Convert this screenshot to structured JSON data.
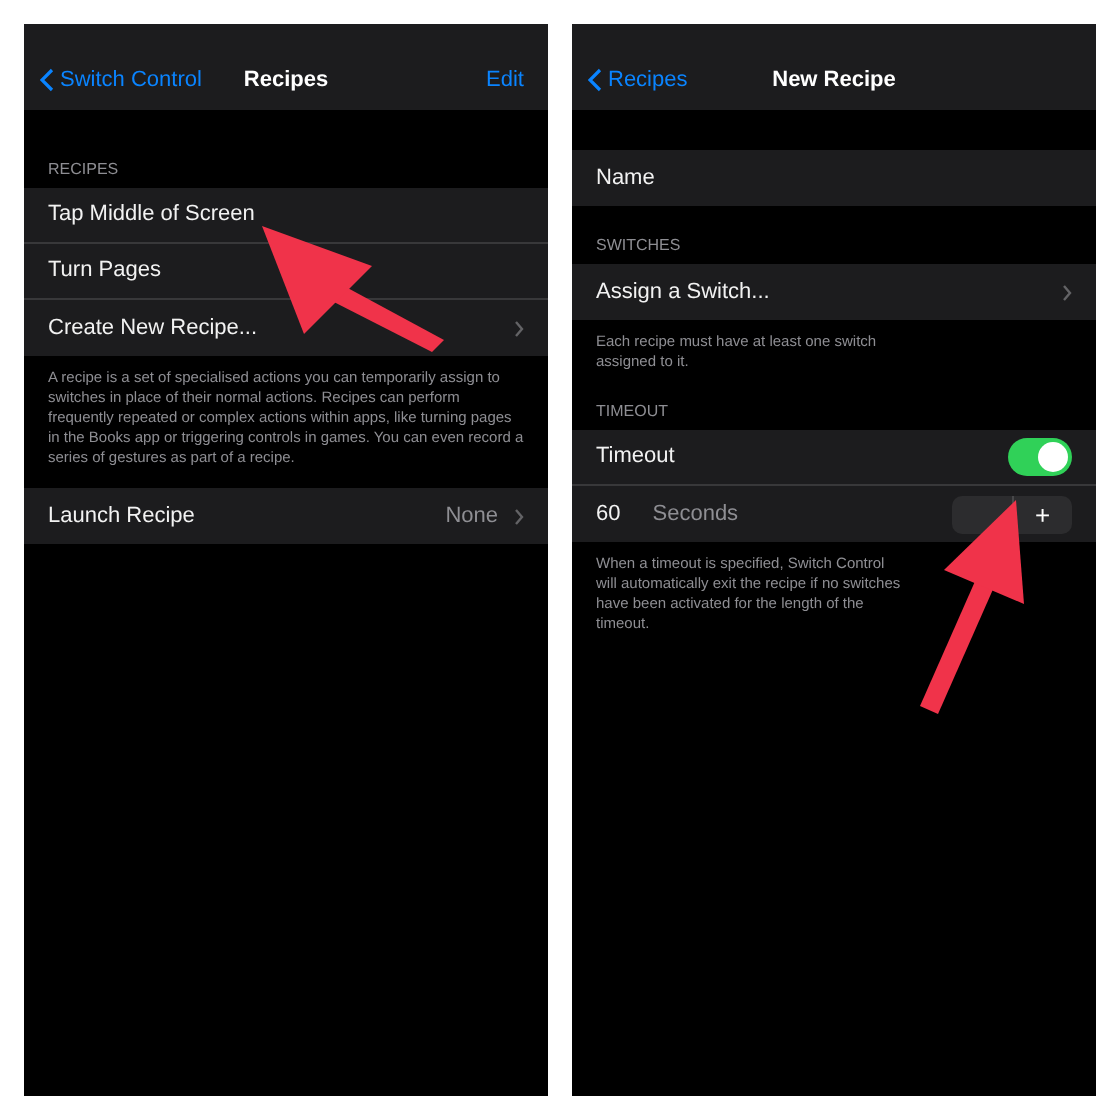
{
  "screens": [
    {
      "nav": {
        "back": "Switch Control",
        "title": "Recipes",
        "action": "Edit"
      },
      "sections": [
        {
          "header": "RECIPES",
          "rows": [
            {
              "label": "Tap Middle of Screen",
              "chevron": false
            },
            {
              "label": "Turn Pages",
              "chevron": false
            },
            {
              "label": "Create New Recipe...",
              "chevron": true
            }
          ],
          "footer": "A recipe is a set of specialised actions you can temporarily assign to switches in place of their normal actions. Recipes can perform frequently repeated or complex actions within apps, like turning pages in the Books app or triggering controls in games. You can even record a series of gestures as part of a recipe."
        },
        {
          "rows": [
            {
              "label": "Launch Recipe",
              "value": "None",
              "chevron": true
            }
          ]
        }
      ]
    },
    {
      "nav": {
        "back": "Recipes",
        "title": "New Recipe"
      },
      "sections": [
        {
          "rows": [
            {
              "label": "Name",
              "chevron": false
            }
          ]
        },
        {
          "header": "SWITCHES",
          "rows": [
            {
              "label": "Assign a Switch...",
              "chevron": true
            }
          ],
          "footer": "Each recipe must have at least one switch assigned to it."
        },
        {
          "header": "TIMEOUT",
          "rows": [
            {
              "label": "Timeout",
              "kind": "toggle",
              "on": true
            },
            {
              "label": "60",
              "unit": "Seconds",
              "kind": "stepper",
              "plus": "+"
            }
          ],
          "footer": "When a timeout is specified, Switch Control will automatically exit the recipe if no switches have been activated for the length of the timeout."
        }
      ]
    }
  ]
}
